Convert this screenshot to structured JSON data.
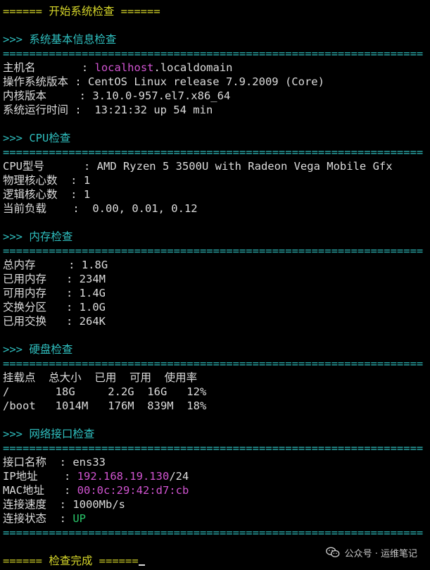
{
  "header": "====== 开始系统检查 ======",
  "separator": "================================================================",
  "sections": {
    "basic": {
      "title": ">>> 系统基本信息检查",
      "hostname_label": "主机名       : ",
      "hostname_pink": "localhost",
      "hostname_rest": ".localdomain",
      "os_line": "操作系统版本 : CentOS Linux release 7.9.2009 (Core)",
      "kernel_line": "内核版本     : 3.10.0-957.el7.x86_64",
      "uptime_line": "系统运行时间 :  13:21:32 up 54 min"
    },
    "cpu": {
      "title": ">>> CPU检查",
      "model_line": "CPU型号      : AMD Ryzen 5 3500U with Radeon Vega Mobile Gfx",
      "physical_line": "物理核心数  : 1",
      "logical_line": "逻辑核心数  : 1",
      "load_line": "当前负载    :  0.00, 0.01, 0.12"
    },
    "memory": {
      "title": ">>> 内存检查",
      "total_line": "总内存     : 1.8G",
      "used_line": "已用内存   : 234M",
      "avail_line": "可用内存   : 1.4G",
      "swap_line": "交换分区   : 1.0G",
      "swap_used_line": "已用交换   : 264K"
    },
    "disk": {
      "title": ">>> 硬盘检查",
      "header_line": "挂载点  总大小  已用  可用  使用率",
      "rows": [
        "/       18G     2.2G  16G   12%",
        "/boot   1014M   176M  839M  18%"
      ]
    },
    "network": {
      "title": ">>> 网络接口检查",
      "iface_line": "接口名称  : ens33",
      "ip_label": "IP地址    : ",
      "ip_pink": "192.168.19.130",
      "ip_rest": "/24",
      "mac_label": "MAC地址   : ",
      "mac_pink": "00:0c:29:42:d7:cb",
      "speed_line": "连接速度  : 1000Mb/s",
      "state_label": "连接状态  : ",
      "state_green": "UP"
    }
  },
  "footer": "====== 检查完成 ======",
  "watermark": "公众号 · 运维笔记"
}
